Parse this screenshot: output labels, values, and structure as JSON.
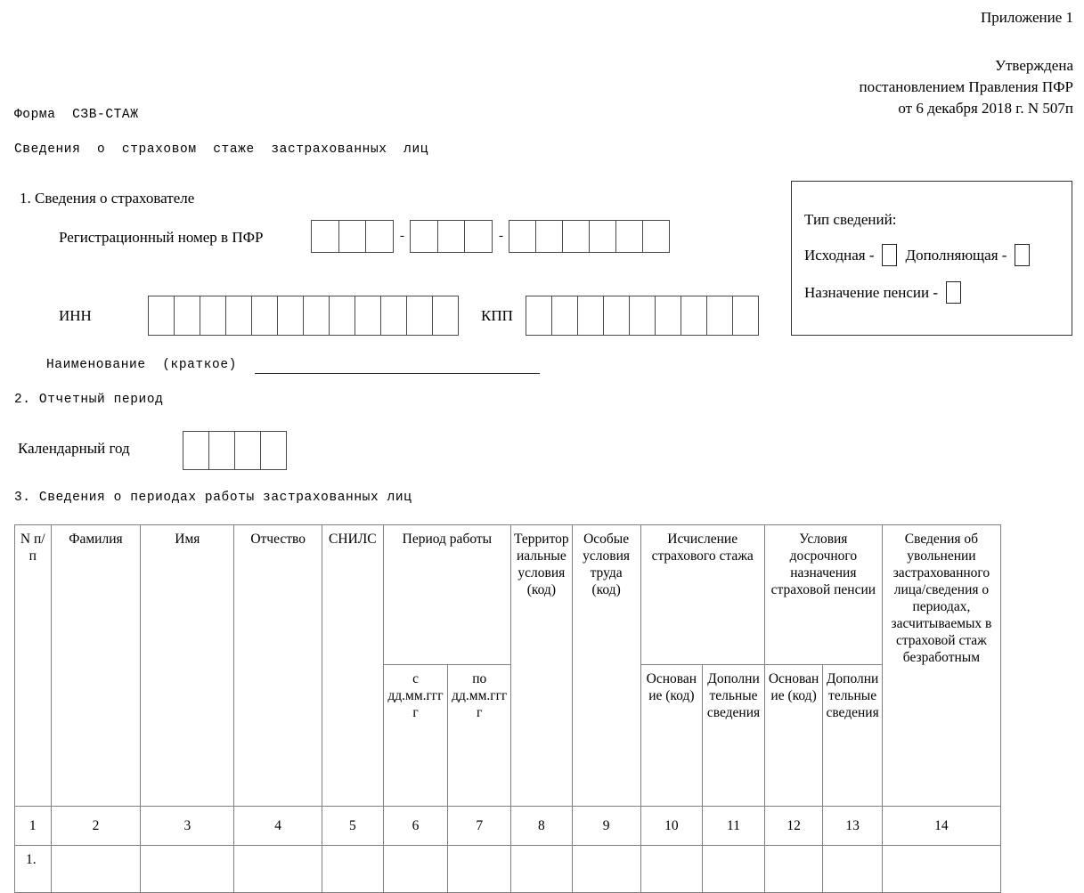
{
  "approval": {
    "appendix": "Приложение 1",
    "approved_label": "Утверждена",
    "approved_by": "постановлением Правления ПФР",
    "approved_date": "от 6 декабря 2018 г. N 507п"
  },
  "form": {
    "form_name": "Форма  СЗВ-СТАЖ",
    "form_subtitle": "Сведения  о  страховом  стаже  застрахованных  лиц"
  },
  "section1": {
    "heading": "1. Сведения о страхователе",
    "reg_number_label": "Регистрационный номер в ПФР",
    "reg_number_groups": [
      3,
      3,
      6
    ],
    "reg_number_separator": "-",
    "inn_label": "ИНН",
    "inn_boxes": 12,
    "kpp_label": "КПП",
    "kpp_boxes": 9,
    "short_name_label": "Наименование  (краткое)",
    "short_name_value": ""
  },
  "info_box": {
    "title": "Тип сведений:",
    "initial_label": "Исходная -",
    "initial_checked": "",
    "supplementary_label": "Дополняющая -",
    "supplementary_checked": "",
    "pension_label": "Назначение пенсии -",
    "pension_checked": ""
  },
  "section2": {
    "heading": "2. Отчетный период",
    "calendar_year_label": "Календарный год",
    "calendar_year_boxes": 4,
    "calendar_year_value": ""
  },
  "section3": {
    "heading": "3. Сведения о периодах работы застрахованных лиц",
    "table": {
      "header_top": [
        "N п/п",
        "Фамилия",
        "Имя",
        "Отчество",
        "СНИЛС",
        "Период работы",
        "Территориальные условия (код)",
        "Особые условия труда (код)",
        "Исчисление страхового стажа",
        "Условия досрочного назначения страховой пенсии",
        "Сведения об увольнении застрахованного лица/сведения о периодах, засчитываемых в страховой стаж безработным"
      ],
      "header_sub": {
        "period_from": "с дд.мм.гггг",
        "period_to": "по дд.мм.гггг",
        "calc_basis": "Основание (код)",
        "calc_extra": "Дополнительные сведения",
        "early_basis": "Основание (код)",
        "early_extra": "Дополнительные сведения"
      },
      "numbering_row": [
        "1",
        "2",
        "3",
        "4",
        "5",
        "6",
        "7",
        "8",
        "9",
        "10",
        "11",
        "12",
        "13",
        "14"
      ],
      "rows": [
        {
          "index": "1.",
          "cells": [
            "",
            "",
            "",
            "",
            "",
            "",
            "",
            "",
            "",
            "",
            "",
            "",
            ""
          ]
        }
      ]
    }
  }
}
